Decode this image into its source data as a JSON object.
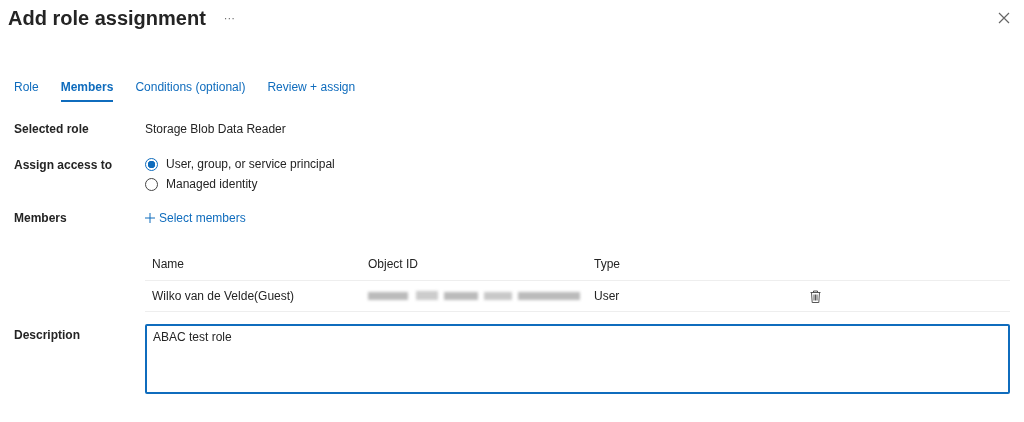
{
  "window": {
    "title": "Add role assignment",
    "more": "···"
  },
  "tabs": [
    {
      "label": "Role",
      "selected": false
    },
    {
      "label": "Members",
      "selected": true
    },
    {
      "label": "Conditions (optional)",
      "selected": false
    },
    {
      "label": "Review + assign",
      "selected": false
    }
  ],
  "selected_role": {
    "label": "Selected role",
    "value": "Storage Blob Data Reader"
  },
  "assign_access": {
    "label": "Assign access to",
    "options": [
      {
        "label": "User, group, or service principal",
        "selected": true
      },
      {
        "label": "Managed identity",
        "selected": false
      }
    ]
  },
  "members": {
    "label": "Members",
    "action": "Select members",
    "columns": [
      "Name",
      "Object ID",
      "Type"
    ],
    "rows": [
      {
        "name": "Wilko van de Velde(Guest)",
        "object_id": {
          "kind": "redacted"
        },
        "type": "User"
      }
    ]
  },
  "description": {
    "label": "Description",
    "value": "ABAC test role"
  }
}
